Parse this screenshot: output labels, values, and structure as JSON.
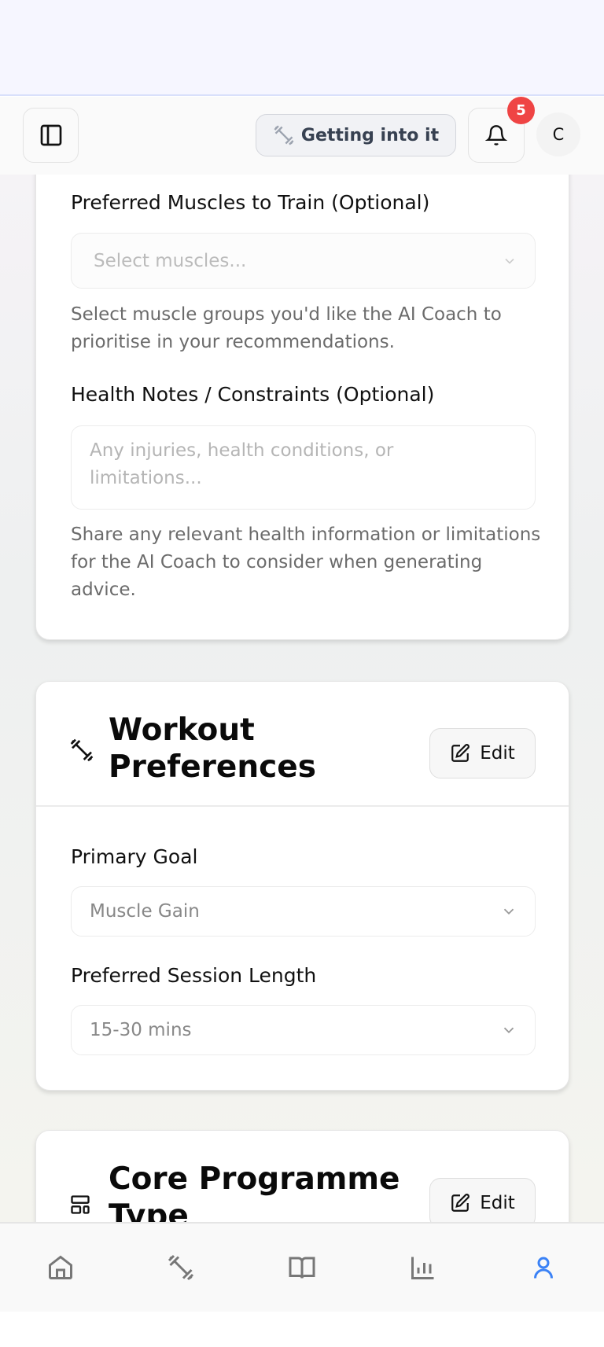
{
  "header": {
    "level_label": "Getting into it",
    "notification_count": "5",
    "avatar_initial": "C"
  },
  "health": {
    "muscles_label": "Preferred Muscles to Train (Optional)",
    "muscles_placeholder": "Select muscles...",
    "muscles_help": "Select muscle groups you'd like the AI Coach to prioritise in your recommendations.",
    "notes_label": "Health Notes / Constraints (Optional)",
    "notes_placeholder": "Any injuries, health conditions, or limitations...",
    "notes_help": "Share any relevant health information or limitations for the AI Coach to consider when generating advice."
  },
  "workout": {
    "title": "Workout Preferences",
    "edit_label": "Edit",
    "goal_label": "Primary Goal",
    "goal_value": "Muscle Gain",
    "session_label": "Preferred Session Length",
    "session_value": "15-30 mins"
  },
  "programme": {
    "title": "Core Programme Type",
    "edit_label": "Edit"
  },
  "nav": {
    "active": "profile",
    "active_color": "#3b82f6",
    "items": [
      "home",
      "workouts",
      "library",
      "stats",
      "profile"
    ]
  }
}
